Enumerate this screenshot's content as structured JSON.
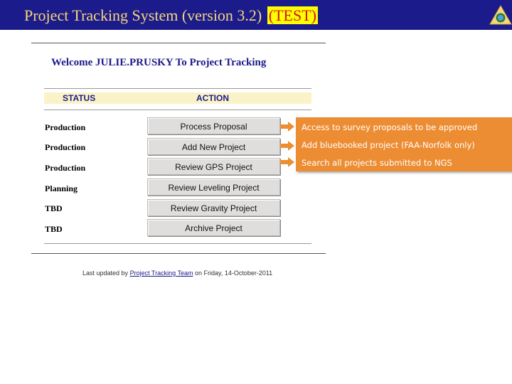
{
  "header": {
    "title": "Project Tracking System (version 3.2)",
    "test_badge": "(TEST)",
    "colors": {
      "bar": "#1b1b8c",
      "title_text": "#f5d77a",
      "badge_text": "#d8121b",
      "badge_bg": "#ffff00"
    }
  },
  "logo": {
    "icon": "agency-seal-icon"
  },
  "welcome": {
    "text": "Welcome JULIE.PRUSKY To Project Tracking"
  },
  "table": {
    "columns": {
      "status": "STATUS",
      "action": "ACTION"
    },
    "rows": [
      {
        "status": "Production",
        "action": "Process Proposal"
      },
      {
        "status": "Production",
        "action": "Add New Project"
      },
      {
        "status": "Production",
        "action": "Review GPS Project"
      },
      {
        "status": "Planning",
        "action": "Review Leveling Project"
      },
      {
        "status": "TBD",
        "action": "Review Gravity Project"
      },
      {
        "status": "TBD",
        "action": "Archive Project"
      }
    ]
  },
  "callout": {
    "color": "#ed8d33",
    "lines": [
      "Access to survey proposals to be approved",
      "Add bluebooked project (FAA-Norfolk only)",
      "Search all projects submitted to NGS"
    ]
  },
  "footer": {
    "prefix": "Last updated by",
    "link": "Project Tracking Team",
    "suffix": "on Friday, 14-October-2011"
  }
}
